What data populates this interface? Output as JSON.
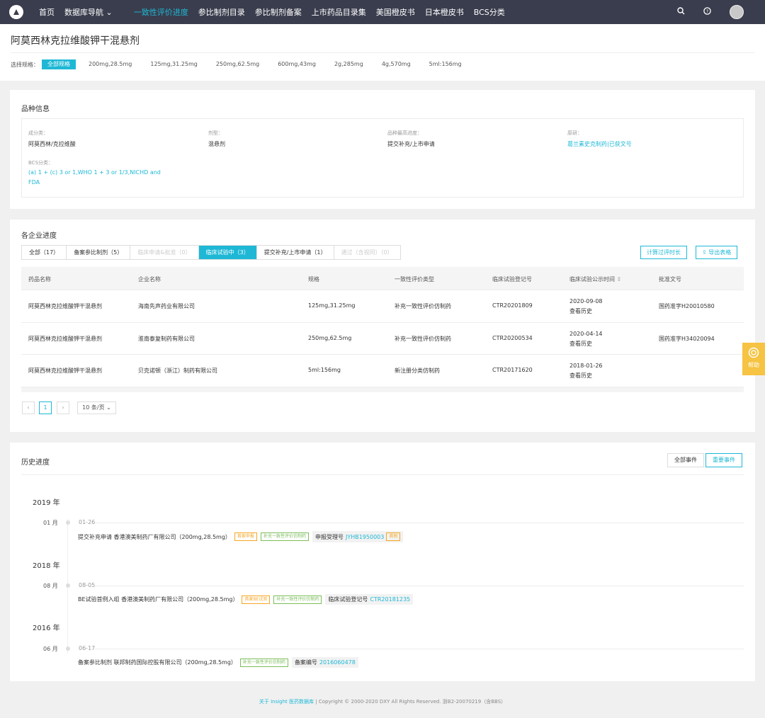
{
  "nav": {
    "items": [
      {
        "label": "首页"
      },
      {
        "label": "数据库导航 ⌄"
      },
      {
        "label": "一致性评价进度"
      },
      {
        "label": "参比制剂目录"
      },
      {
        "label": "参比制剂备案"
      },
      {
        "label": "上市药品目录集"
      },
      {
        "label": "美国橙皮书"
      },
      {
        "label": "日本橙皮书"
      },
      {
        "label": "BCS分类"
      }
    ],
    "search_icon": "search-icon",
    "help_icon": "question-icon"
  },
  "page": {
    "title": "阿莫西林克拉维酸钾干混悬剂",
    "spec_label": "选择规格：",
    "specs": [
      "全部规格",
      "200mg,28.5mg",
      "125mg,31.25mg",
      "250mg,62.5mg",
      "600mg,43mg",
      "2g,285mg",
      "4g,570mg",
      "5ml:156mg"
    ]
  },
  "variety": {
    "title": "品种信息",
    "component_label": "成分类：",
    "component_value": "阿莫西林/克拉维酸",
    "form_label": "剂型：",
    "form_value": "混悬剂",
    "progress_label": "品种最高进度：",
    "progress_value": "提交补充/上市申请",
    "origin_label": "原研：",
    "origin_value": "葛兰素史克制药|已获文号",
    "bcs_label": "BCS分类：",
    "bcs_line1": "(a) 1 + (c) 3 or 1,WHO 1 + 3 or 1/3,NICHD and",
    "bcs_line2": "FDA"
  },
  "enterprise": {
    "title": "各企业进度",
    "tabs": [
      {
        "label": "全部（17）",
        "state": "normal"
      },
      {
        "label": "备案参比制剂（5）",
        "state": "normal"
      },
      {
        "label": "临床申请&批准（0）",
        "state": "disabled"
      },
      {
        "label": "临床试验中（3）",
        "state": "active"
      },
      {
        "label": "提交补充/上市申请（1）",
        "state": "normal"
      },
      {
        "label": "通过（含视同）（0）",
        "state": "disabled"
      }
    ],
    "calc_button": "计算过评时长",
    "export_button": "导出表格",
    "columns": [
      "药品名称",
      "企业名称",
      "规格",
      "一致性评价类型",
      "临床试验登记号",
      "临床试验公示时间",
      "批准文号"
    ],
    "rows": [
      {
        "drug": "阿莫西林克拉维酸钾干混悬剂",
        "company": "海南先声药业有限公司",
        "spec": "125mg,31.25mg",
        "type": "补充一致性评价仿制药",
        "reg": "CTR20201809",
        "date": "2020-09-08",
        "history": "查看历史",
        "approval": "国药准字H20010580"
      },
      {
        "drug": "阿莫西林克拉维酸钾干混悬剂",
        "company": "淮南泰复制药有限公司",
        "spec": "250mg,62.5mg",
        "type": "补充一致性评价仿制药",
        "reg": "CTR20200534",
        "date": "2020-04-14",
        "history": "查看历史",
        "approval": "国药准字H34020094"
      },
      {
        "drug": "阿莫西林克拉维酸钾干混悬剂",
        "company": "贝克诺顿（浙江）制药有限公司",
        "spec": "5ml:156mg",
        "type": "新注册分类仿制药",
        "reg": "CTR20171620",
        "date": "2018-01-26",
        "history": "查看历史",
        "approval": ""
      }
    ],
    "pagination": {
      "prev": "‹",
      "page": "1",
      "next": "›",
      "size": "10 条/页 ⌄"
    }
  },
  "history": {
    "title": "历史进度",
    "btn_all": "全部事件",
    "btn_important": "重要事件",
    "events": [
      {
        "year": "2019 年",
        "month": "01 月",
        "date": "01-26",
        "text": "提交补充申请 香港澳美制药厂有限公司（200mg,28.5mg）",
        "tag1": "首家申报",
        "tag2": "补充一致性评价仿制药",
        "box_label": "申报受理号",
        "box_value": "JYHB1950003",
        "box_tag": "首例"
      },
      {
        "year": "2018 年",
        "month": "08 月",
        "date": "08-05",
        "text": "BE试验首例入组 香港澳美制药厂有限公司（200mg,28.5mg）",
        "tag1": "首家BE试验",
        "tag2": "补充一致性评价仿制药",
        "box_label": "临床试验登记号",
        "box_value": "CTR20181235",
        "box_tag": ""
      },
      {
        "year": "2016 年",
        "month": "06 月",
        "date": "06-17",
        "text": "备案参比制剂 联邦制药国际控股有限公司（200mg,28.5mg）",
        "tag1": "",
        "tag2": "补充一致性评价仿制药",
        "box_label": "备案编号",
        "box_value": "2016060478",
        "box_tag": ""
      }
    ]
  },
  "help": {
    "label": "帮助"
  },
  "footer": {
    "link": "关于 Insight 医药数据库",
    "text": " | Copyright © 2000-2020 DXY All Rights Reserved. 浙B2-20070219（含BBS）"
  },
  "colors": {
    "accent": "#1eb8d6",
    "nav_bg": "#3a3d4d",
    "tag_orange": "#f5a623",
    "tag_green": "#7cbd5a",
    "help_bg": "#f6c342"
  }
}
